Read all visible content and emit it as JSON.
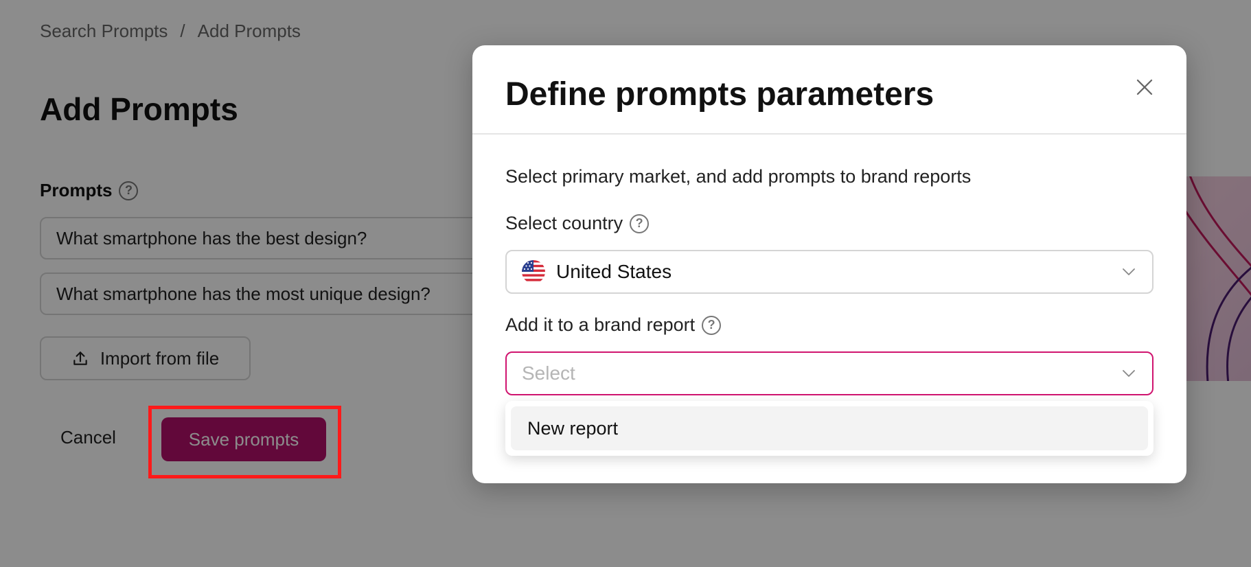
{
  "breadcrumb": {
    "items": [
      "Search Prompts",
      "Add Prompts"
    ],
    "separator": "/"
  },
  "page": {
    "title": "Add Prompts",
    "prompts_label": "Prompts",
    "prompts": [
      "What smartphone has the best design?",
      "What smartphone has the most unique design?"
    ],
    "import_label": "Import from file",
    "cancel_label": "Cancel",
    "save_label": "Save prompts"
  },
  "modal": {
    "title": "Define prompts parameters",
    "description": "Select primary market, and add prompts to brand reports",
    "country_label": "Select country",
    "country_value": "United States",
    "brand_label": "Add it to a brand report",
    "brand_placeholder": "Select",
    "dropdown_options": [
      "New report"
    ]
  },
  "icons": {
    "help": "question-circle-icon",
    "close": "close-icon",
    "chevron": "chevron-down-icon",
    "upload": "upload-icon",
    "flag": "us-flag-icon"
  },
  "colors": {
    "accent": "#b3106b",
    "focus_border": "#d0146f",
    "highlight": "#ff1a1a"
  }
}
